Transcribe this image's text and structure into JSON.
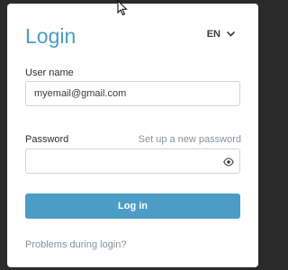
{
  "login": {
    "title": "Login",
    "language": "EN",
    "username_label": "User name",
    "username_value": "myemail@gmail.com",
    "password_label": "Password",
    "password_value": "",
    "reset_link": "Set up a new password",
    "login_button": "Log in",
    "problems_link": "Problems during login?"
  },
  "icons": {
    "language_toggle": "chevron-down-icon",
    "password_visibility": "eye-icon",
    "pointer": "mouse-cursor-icon"
  },
  "colors": {
    "accent": "#4c9dc6",
    "title": "#4a9cc7",
    "muted_link": "#8b9096",
    "background": "#2a2a2a"
  }
}
